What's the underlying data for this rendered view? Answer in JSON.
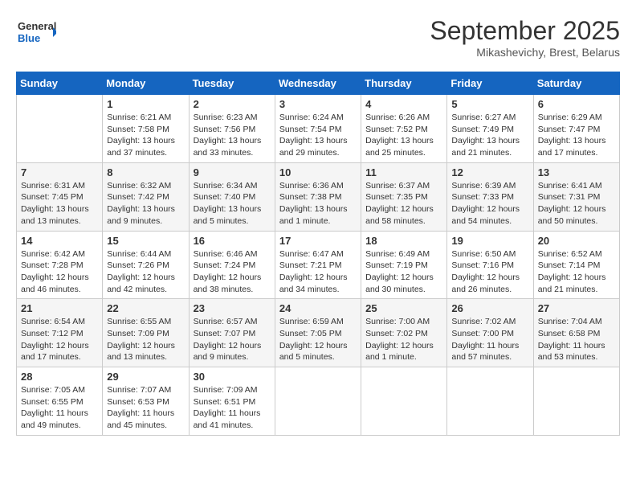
{
  "header": {
    "logo_line1": "General",
    "logo_line2": "Blue",
    "month_title": "September 2025",
    "subtitle": "Mikashevichy, Brest, Belarus"
  },
  "columns": [
    "Sunday",
    "Monday",
    "Tuesday",
    "Wednesday",
    "Thursday",
    "Friday",
    "Saturday"
  ],
  "weeks": [
    [
      {
        "day": "",
        "sunrise": "",
        "sunset": "",
        "daylight": ""
      },
      {
        "day": "1",
        "sunrise": "Sunrise: 6:21 AM",
        "sunset": "Sunset: 7:58 PM",
        "daylight": "Daylight: 13 hours and 37 minutes."
      },
      {
        "day": "2",
        "sunrise": "Sunrise: 6:23 AM",
        "sunset": "Sunset: 7:56 PM",
        "daylight": "Daylight: 13 hours and 33 minutes."
      },
      {
        "day": "3",
        "sunrise": "Sunrise: 6:24 AM",
        "sunset": "Sunset: 7:54 PM",
        "daylight": "Daylight: 13 hours and 29 minutes."
      },
      {
        "day": "4",
        "sunrise": "Sunrise: 6:26 AM",
        "sunset": "Sunset: 7:52 PM",
        "daylight": "Daylight: 13 hours and 25 minutes."
      },
      {
        "day": "5",
        "sunrise": "Sunrise: 6:27 AM",
        "sunset": "Sunset: 7:49 PM",
        "daylight": "Daylight: 13 hours and 21 minutes."
      },
      {
        "day": "6",
        "sunrise": "Sunrise: 6:29 AM",
        "sunset": "Sunset: 7:47 PM",
        "daylight": "Daylight: 13 hours and 17 minutes."
      }
    ],
    [
      {
        "day": "7",
        "sunrise": "Sunrise: 6:31 AM",
        "sunset": "Sunset: 7:45 PM",
        "daylight": "Daylight: 13 hours and 13 minutes."
      },
      {
        "day": "8",
        "sunrise": "Sunrise: 6:32 AM",
        "sunset": "Sunset: 7:42 PM",
        "daylight": "Daylight: 13 hours and 9 minutes."
      },
      {
        "day": "9",
        "sunrise": "Sunrise: 6:34 AM",
        "sunset": "Sunset: 7:40 PM",
        "daylight": "Daylight: 13 hours and 5 minutes."
      },
      {
        "day": "10",
        "sunrise": "Sunrise: 6:36 AM",
        "sunset": "Sunset: 7:38 PM",
        "daylight": "Daylight: 13 hours and 1 minute."
      },
      {
        "day": "11",
        "sunrise": "Sunrise: 6:37 AM",
        "sunset": "Sunset: 7:35 PM",
        "daylight": "Daylight: 12 hours and 58 minutes."
      },
      {
        "day": "12",
        "sunrise": "Sunrise: 6:39 AM",
        "sunset": "Sunset: 7:33 PM",
        "daylight": "Daylight: 12 hours and 54 minutes."
      },
      {
        "day": "13",
        "sunrise": "Sunrise: 6:41 AM",
        "sunset": "Sunset: 7:31 PM",
        "daylight": "Daylight: 12 hours and 50 minutes."
      }
    ],
    [
      {
        "day": "14",
        "sunrise": "Sunrise: 6:42 AM",
        "sunset": "Sunset: 7:28 PM",
        "daylight": "Daylight: 12 hours and 46 minutes."
      },
      {
        "day": "15",
        "sunrise": "Sunrise: 6:44 AM",
        "sunset": "Sunset: 7:26 PM",
        "daylight": "Daylight: 12 hours and 42 minutes."
      },
      {
        "day": "16",
        "sunrise": "Sunrise: 6:46 AM",
        "sunset": "Sunset: 7:24 PM",
        "daylight": "Daylight: 12 hours and 38 minutes."
      },
      {
        "day": "17",
        "sunrise": "Sunrise: 6:47 AM",
        "sunset": "Sunset: 7:21 PM",
        "daylight": "Daylight: 12 hours and 34 minutes."
      },
      {
        "day": "18",
        "sunrise": "Sunrise: 6:49 AM",
        "sunset": "Sunset: 7:19 PM",
        "daylight": "Daylight: 12 hours and 30 minutes."
      },
      {
        "day": "19",
        "sunrise": "Sunrise: 6:50 AM",
        "sunset": "Sunset: 7:16 PM",
        "daylight": "Daylight: 12 hours and 26 minutes."
      },
      {
        "day": "20",
        "sunrise": "Sunrise: 6:52 AM",
        "sunset": "Sunset: 7:14 PM",
        "daylight": "Daylight: 12 hours and 21 minutes."
      }
    ],
    [
      {
        "day": "21",
        "sunrise": "Sunrise: 6:54 AM",
        "sunset": "Sunset: 7:12 PM",
        "daylight": "Daylight: 12 hours and 17 minutes."
      },
      {
        "day": "22",
        "sunrise": "Sunrise: 6:55 AM",
        "sunset": "Sunset: 7:09 PM",
        "daylight": "Daylight: 12 hours and 13 minutes."
      },
      {
        "day": "23",
        "sunrise": "Sunrise: 6:57 AM",
        "sunset": "Sunset: 7:07 PM",
        "daylight": "Daylight: 12 hours and 9 minutes."
      },
      {
        "day": "24",
        "sunrise": "Sunrise: 6:59 AM",
        "sunset": "Sunset: 7:05 PM",
        "daylight": "Daylight: 12 hours and 5 minutes."
      },
      {
        "day": "25",
        "sunrise": "Sunrise: 7:00 AM",
        "sunset": "Sunset: 7:02 PM",
        "daylight": "Daylight: 12 hours and 1 minute."
      },
      {
        "day": "26",
        "sunrise": "Sunrise: 7:02 AM",
        "sunset": "Sunset: 7:00 PM",
        "daylight": "Daylight: 11 hours and 57 minutes."
      },
      {
        "day": "27",
        "sunrise": "Sunrise: 7:04 AM",
        "sunset": "Sunset: 6:58 PM",
        "daylight": "Daylight: 11 hours and 53 minutes."
      }
    ],
    [
      {
        "day": "28",
        "sunrise": "Sunrise: 7:05 AM",
        "sunset": "Sunset: 6:55 PM",
        "daylight": "Daylight: 11 hours and 49 minutes."
      },
      {
        "day": "29",
        "sunrise": "Sunrise: 7:07 AM",
        "sunset": "Sunset: 6:53 PM",
        "daylight": "Daylight: 11 hours and 45 minutes."
      },
      {
        "day": "30",
        "sunrise": "Sunrise: 7:09 AM",
        "sunset": "Sunset: 6:51 PM",
        "daylight": "Daylight: 11 hours and 41 minutes."
      },
      {
        "day": "",
        "sunrise": "",
        "sunset": "",
        "daylight": ""
      },
      {
        "day": "",
        "sunrise": "",
        "sunset": "",
        "daylight": ""
      },
      {
        "day": "",
        "sunrise": "",
        "sunset": "",
        "daylight": ""
      },
      {
        "day": "",
        "sunrise": "",
        "sunset": "",
        "daylight": ""
      }
    ]
  ]
}
